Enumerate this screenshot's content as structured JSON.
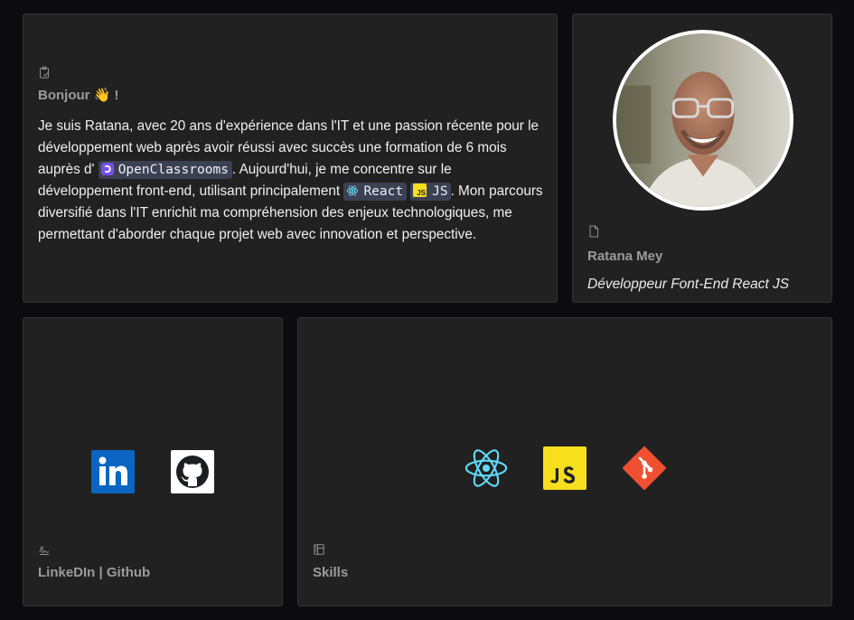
{
  "intro": {
    "icon": "clipboard-icon",
    "title": "Bonjour 👋 !",
    "text_1": "Je suis Ratana, avec 20 ans d'expérience dans l'IT et une passion récente pour le développement web après avoir réussi avec succès une formation de 6 mois auprès d' ",
    "openclassrooms": "OpenClassrooms",
    "text_2": ". Aujourd'hui, je me concentre sur le développement front-end, utilisant principalement ",
    "react": "React",
    "js": "JS",
    "text_3": ". Mon parcours diversifié dans l'IT enrichit ma compréhension des enjeux technologiques, me permettant d'aborder chaque projet web avec innovation et perspective."
  },
  "profile": {
    "icon": "document-icon",
    "name": "Ratana Mey",
    "role": "Développeur Font-End React JS"
  },
  "social": {
    "icon": "signature-icon",
    "title": "LinkeDIn | Github",
    "logos": [
      "linkedin-logo",
      "github-logo"
    ]
  },
  "skills": {
    "icon": "layout-icon",
    "title": "Skills",
    "logos": [
      "react-logo",
      "javascript-logo",
      "git-logo"
    ]
  },
  "colors": {
    "background": "#0c0c0e",
    "card": "#212121",
    "linkedin": "#0a66c2",
    "javascript": "#f7df1e",
    "react": "#61dafb",
    "git": "#f05032",
    "openclassrooms": "#7451eb"
  }
}
